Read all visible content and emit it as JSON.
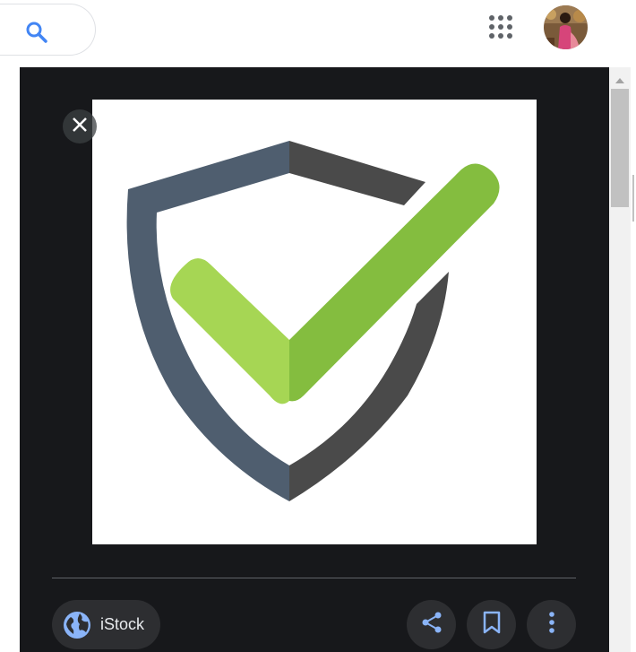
{
  "source": {
    "name": "iStock"
  },
  "colors": {
    "panel_bg": "#17181b",
    "shield_left": "#4f5e6f",
    "shield_right": "#4a4a4a",
    "check_light": "#a6d654",
    "check_dark": "#84bd3f",
    "accent_blue": "#8ab4f8"
  },
  "icons": {
    "mic": "mic-icon",
    "search": "search-icon",
    "apps": "apps-grid-icon",
    "close": "close-icon",
    "globe": "globe-icon",
    "share": "share-icon",
    "save": "bookmark-icon",
    "more": "more-vert-icon"
  }
}
